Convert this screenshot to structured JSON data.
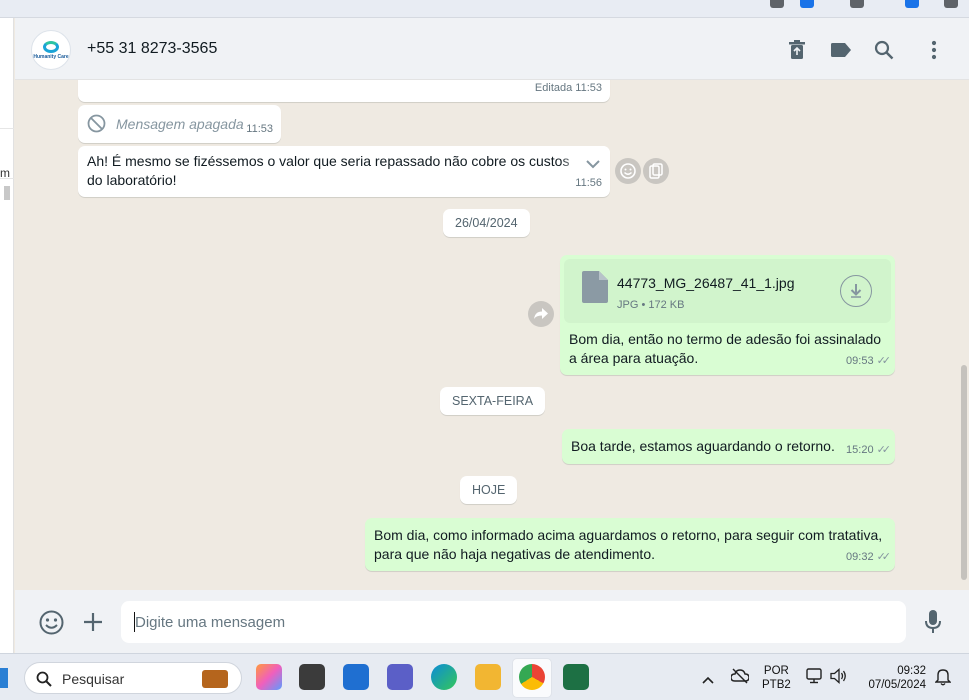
{
  "header": {
    "contact_name": "+55 31 8273-3565",
    "avatar_text": "Humanity Care"
  },
  "messages": [
    {
      "id": "m1",
      "type": "incoming",
      "meta": "Editada 11:53"
    },
    {
      "id": "m2",
      "type": "incoming",
      "deleted_text": "Mensagem apagada",
      "time": "11:53"
    },
    {
      "id": "m3",
      "type": "incoming",
      "text": "Ah! É mesmo se fizéssemos o valor que seria repassado não cobre os custos do laboratório!",
      "time": "11:56"
    },
    {
      "id": "d1",
      "type": "date",
      "text": "26/04/2024"
    },
    {
      "id": "m4",
      "type": "outgoing",
      "file_name": "44773_MG_26487_41_1.jpg",
      "file_meta": "JPG • 172 KB",
      "text": "Bom dia, então no termo de adesão foi assinalado a área para atuação.",
      "time": "09:53"
    },
    {
      "id": "d2",
      "type": "date",
      "text": "SEXTA-FEIRA"
    },
    {
      "id": "m5",
      "type": "outgoing",
      "text": "Boa tarde, estamos aguardando o retorno.",
      "time": "15:20"
    },
    {
      "id": "d3",
      "type": "date",
      "text": "HOJE"
    },
    {
      "id": "m6",
      "type": "outgoing",
      "text": "Bom dia, como informado acima aguardamos o retorno, para seguir com tratativa, para que não haja negativas de atendimento.",
      "time": "09:32"
    }
  ],
  "composer": {
    "placeholder": "Digite uma mensagem"
  },
  "taskbar": {
    "search_label": "Pesquisar",
    "language_line1": "POR",
    "language_line2": "PTB2",
    "clock_time": "09:32",
    "clock_date": "07/05/2024"
  },
  "left_panel": {
    "cut_text": "m"
  },
  "colors": {
    "chat_bg": "#efeae2",
    "outgoing_bubble": "#d9fdd3",
    "incoming_bubble": "#ffffff",
    "header_bg": "#f0f2f5"
  }
}
